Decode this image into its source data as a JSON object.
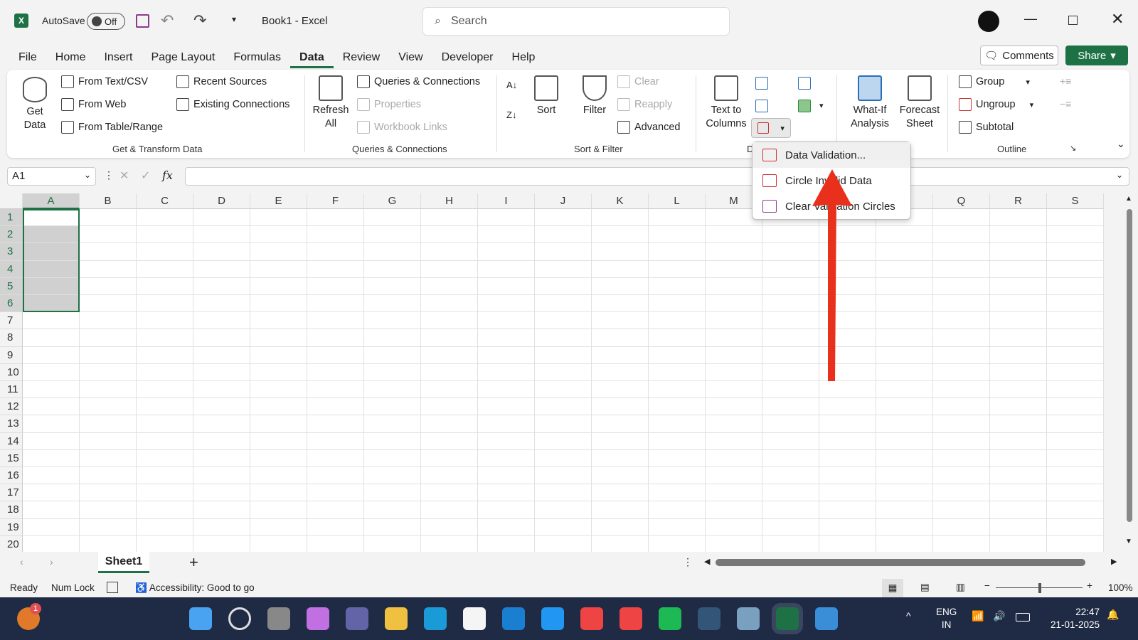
{
  "title": {
    "autosave": "AutoSave",
    "toggle": "Off",
    "doc": "Book1 - Excel",
    "search_placeholder": "Search"
  },
  "tabs": [
    "File",
    "Home",
    "Insert",
    "Page Layout",
    "Formulas",
    "Data",
    "Review",
    "View",
    "Developer",
    "Help"
  ],
  "active_tab": "Data",
  "actions": {
    "comments": "Comments",
    "share": "Share"
  },
  "ribbon": {
    "get_data": "Get\nData",
    "from_text": "From Text/CSV",
    "from_web": "From Web",
    "from_table": "From Table/Range",
    "recent": "Recent Sources",
    "existing": "Existing Connections",
    "group1": "Get & Transform Data",
    "refresh": "Refresh\nAll",
    "queries": "Queries & Connections",
    "properties": "Properties",
    "links": "Workbook Links",
    "group2": "Queries & Connections",
    "sort": "Sort",
    "filter": "Filter",
    "clear": "Clear",
    "reapply": "Reapply",
    "advanced": "Advanced",
    "group3": "Sort & Filter",
    "text_to_columns": "Text to\nColumns",
    "group4": "D",
    "whatif": "What-If\nAnalysis",
    "forecast": "Forecast\nSheet",
    "group_btn": "Group",
    "ungroup": "Ungroup",
    "subtotal": "Subtotal",
    "group5": "Outline"
  },
  "menu": [
    "Data Validation...",
    "Circle Invalid Data",
    "Clear Validation Circles"
  ],
  "namebox": "A1",
  "columns": [
    "A",
    "B",
    "C",
    "D",
    "E",
    "F",
    "G",
    "H",
    "I",
    "J",
    "K",
    "L",
    "M",
    "N",
    "O",
    "P",
    "Q",
    "R",
    "S"
  ],
  "rows": [
    "1",
    "2",
    "3",
    "4",
    "5",
    "6",
    "7",
    "8",
    "9",
    "10",
    "11",
    "12",
    "13",
    "14",
    "15",
    "16",
    "17",
    "18",
    "19",
    "20"
  ],
  "sheet": "Sheet1",
  "status": {
    "ready": "Ready",
    "numlock": "Num Lock",
    "accessibility": "Accessibility: Good to go",
    "zoom": "100%"
  },
  "taskbar": {
    "lang1": "ENG",
    "lang2": "IN",
    "time": "22:47",
    "date": "21-01-2025",
    "badge": "1"
  },
  "colors": {
    "accent": "#1e7145",
    "arrow": "#e8301c",
    "taskbar": "#1f2a44"
  }
}
